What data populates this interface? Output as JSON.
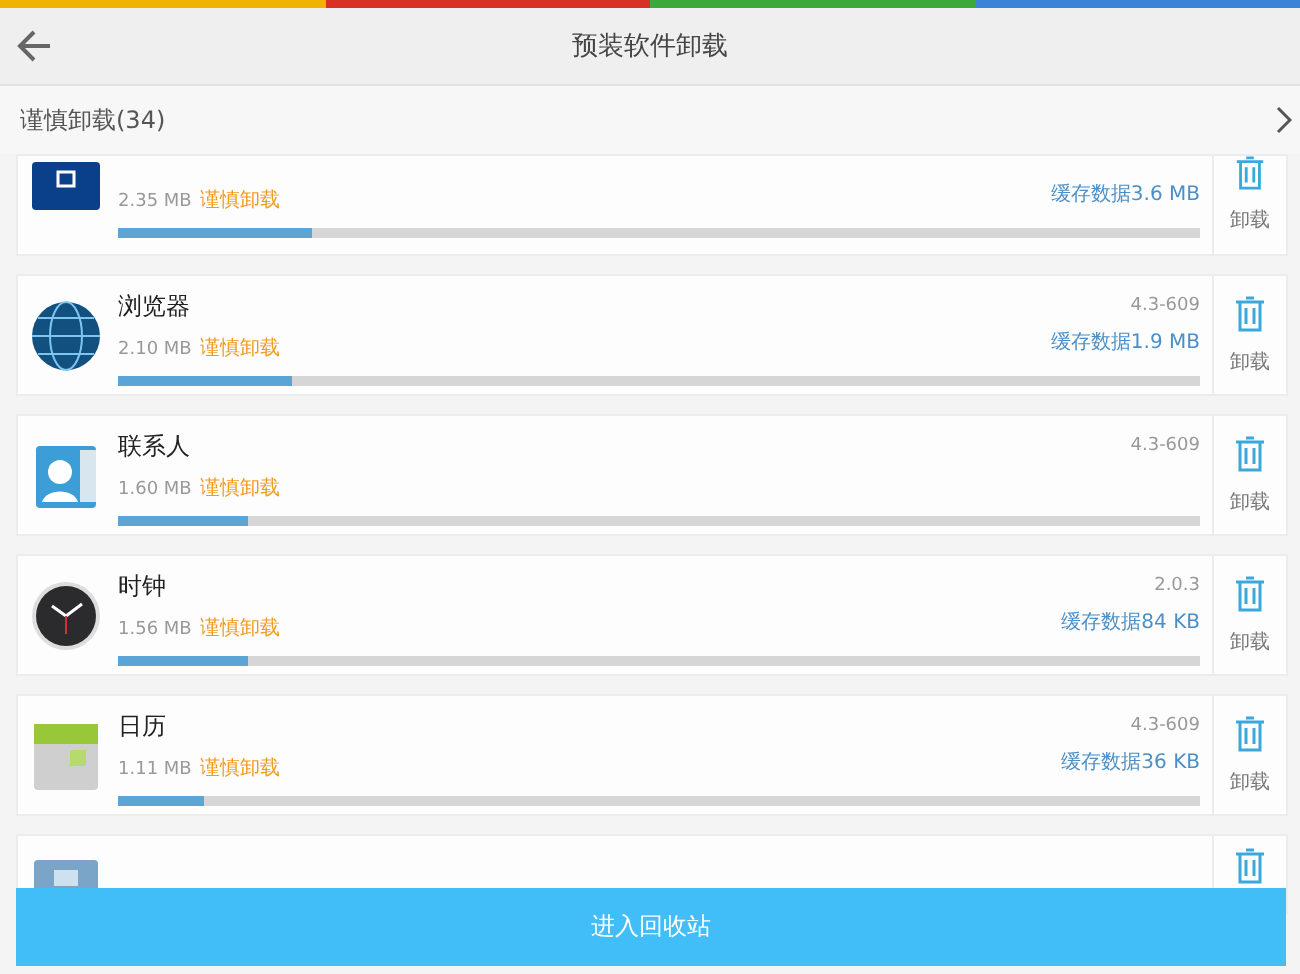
{
  "header": {
    "title": "预装软件卸载"
  },
  "section": {
    "label": "谨慎卸载(34)"
  },
  "apps": [
    {
      "kind": "cut_top",
      "size": "2.35 MB",
      "tag": "谨慎卸载",
      "cache": "缓存数据3.6 MB",
      "level": 0.18,
      "action": "卸载"
    },
    {
      "kind": "full",
      "name": "浏览器",
      "size": "2.10 MB",
      "tag": "谨慎卸载",
      "version": "4.3-609",
      "cache": "缓存数据1.9 MB",
      "level": 0.16,
      "action": "卸载"
    },
    {
      "kind": "full",
      "name": "联系人",
      "size": "1.60 MB",
      "tag": "谨慎卸载",
      "version": "4.3-609",
      "level": 0.12,
      "action": "卸载"
    },
    {
      "kind": "full",
      "name": "时钟",
      "size": "1.56 MB",
      "tag": "谨慎卸载",
      "version": "2.0.3",
      "cache": "缓存数据84 KB",
      "level": 0.12,
      "action": "卸载"
    },
    {
      "kind": "full",
      "name": "日历",
      "size": "1.11 MB",
      "tag": "谨慎卸载",
      "version": "4.3-609",
      "cache": "缓存数据36 KB",
      "level": 0.08,
      "action": "卸载"
    },
    {
      "kind": "cut_bottom"
    }
  ],
  "footer_button": {
    "label": "进入回收站"
  }
}
